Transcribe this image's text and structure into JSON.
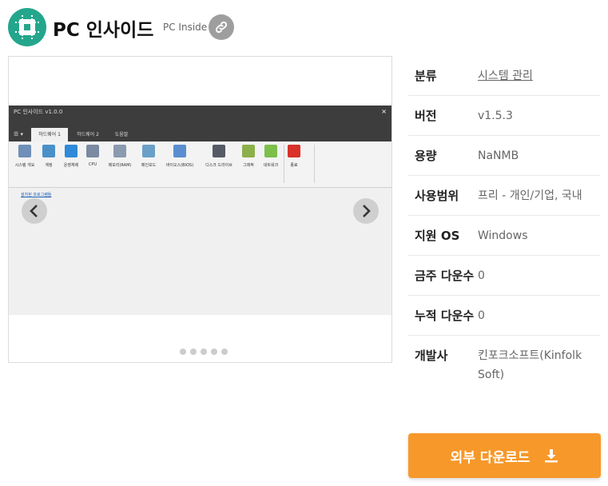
{
  "header": {
    "title": "PC 인사이드",
    "subtitle": "PC Inside",
    "logo_icon": "cpu-chip-icon",
    "link_icon": "link-icon",
    "accent": "#23a68c"
  },
  "screenshot": {
    "window_title": "PC 인사이드 v1.0.0",
    "close_glyph": "×",
    "system_menu": "☰ ▾",
    "tabs": [
      "하드웨어 1",
      "하드웨어 2",
      "도움말"
    ],
    "ribbon_items": [
      {
        "label": "시스템 개요",
        "icon": "system-overview-icon",
        "color": "#6f8fb8"
      },
      {
        "label": "계정",
        "icon": "accounts-icon",
        "color": "#4a90c8"
      },
      {
        "label": "운영체제",
        "icon": "windows-icon",
        "color": "#2f8ad8"
      },
      {
        "label": "CPU",
        "icon": "cpu-icon",
        "color": "#7a8aa0"
      },
      {
        "label": "메모리(RAM)",
        "icon": "memory-icon",
        "color": "#8a9ab0"
      },
      {
        "label": "메인보드",
        "icon": "mainboard-icon",
        "color": "#6aa0c8"
      },
      {
        "label": "바이오스(BIOS)",
        "icon": "bios-icon",
        "color": "#5a8ed0"
      },
      {
        "label": "디스크 드라이브",
        "icon": "disk-drive-icon",
        "color": "#555b66"
      },
      {
        "label": "그래픽",
        "icon": "graphics-icon",
        "color": "#8bb04a"
      },
      {
        "label": "네트워크",
        "icon": "wifi-icon",
        "color": "#7cbf4a"
      },
      {
        "label": "종료",
        "icon": "exit-icon",
        "color": "#d8322a"
      }
    ],
    "installed_programs_link": "설치된 프로그램들",
    "dots_count": 5
  },
  "info": {
    "rows": [
      {
        "key": "분류",
        "value": "시스템 관리"
      },
      {
        "key": "버전",
        "value": "v1.5.3"
      },
      {
        "key": "용량",
        "value": "NaNMB"
      },
      {
        "key": "사용범위",
        "value": "프리 - 개인/기업, 국내"
      },
      {
        "key": "지원 OS",
        "value": "Windows"
      },
      {
        "key": "금주 다운수",
        "value": "0"
      },
      {
        "key": "누적 다운수",
        "value": "0"
      },
      {
        "key": "개발사",
        "value": "킨포크소프트(Kinfolk Soft)"
      }
    ]
  },
  "download": {
    "label": "외부 다운로드",
    "icon": "download-icon",
    "color": "#f7982a"
  }
}
